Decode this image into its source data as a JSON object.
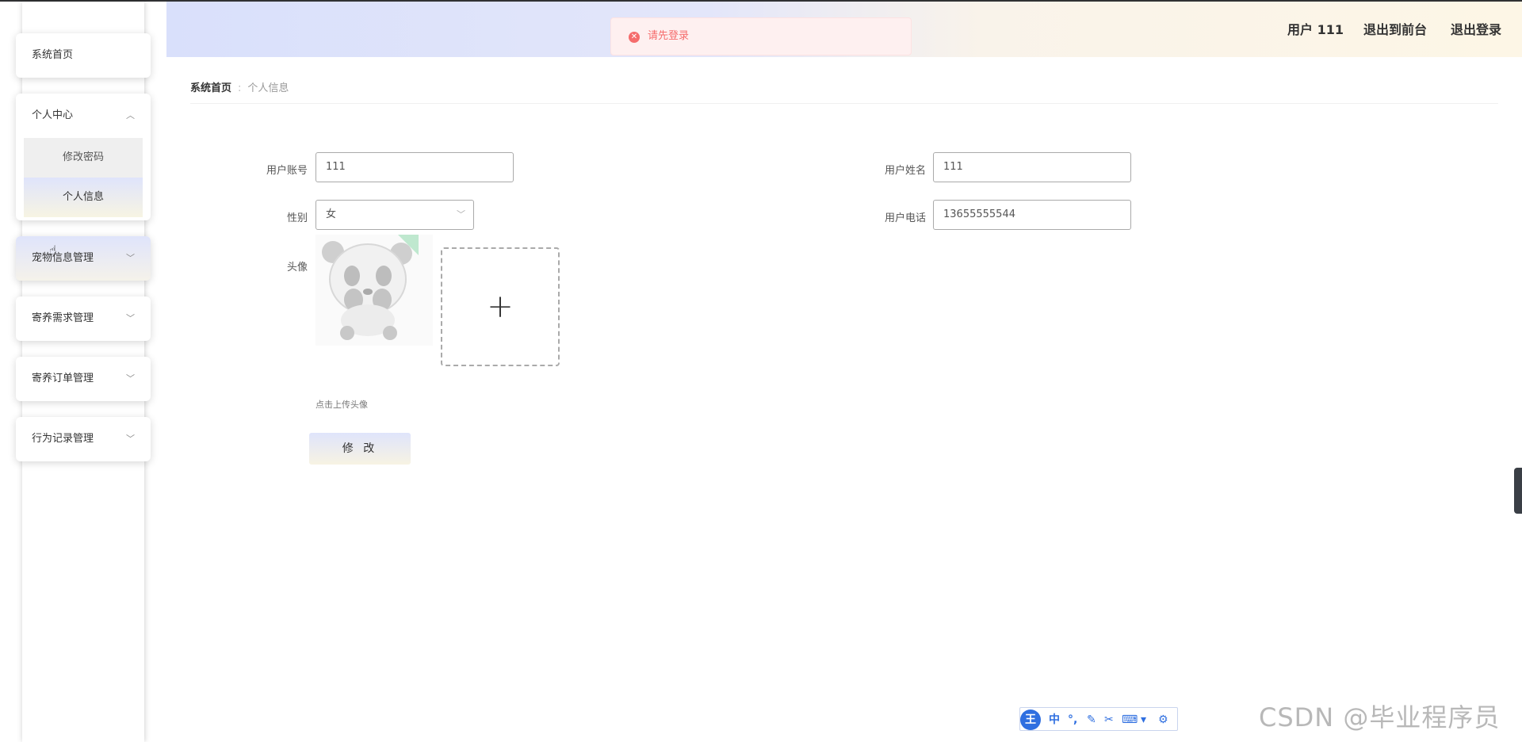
{
  "sidebar": {
    "home": "系统首页",
    "personal": {
      "label": "个人中心",
      "items": [
        "修改密码",
        "个人信息"
      ]
    },
    "menus": [
      "宠物信息管理",
      "寄养需求管理",
      "寄养订单管理",
      "行为记录管理"
    ]
  },
  "header": {
    "user": "用户 111",
    "front": "退出到前台",
    "logout": "退出登录"
  },
  "toast": {
    "message": "请先登录"
  },
  "breadcrumb": {
    "home": "系统首页",
    "separator": ":",
    "current": "个人信息"
  },
  "form": {
    "account_label": "用户账号",
    "account_value": "111",
    "name_label": "用户姓名",
    "name_value": "111",
    "gender_label": "性别",
    "gender_value": "女",
    "phone_label": "用户电话",
    "phone_value": "13655555544",
    "avatar_label": "头像",
    "upload_hint": "点击上传头像",
    "submit": "修 改"
  },
  "ime": {
    "logo": "王",
    "mode": "中"
  },
  "watermark": "CSDN @毕业程序员",
  "colors": {
    "accent": "#d9e0fb",
    "warm": "#fdf6e6",
    "error": "#f56c6c"
  }
}
